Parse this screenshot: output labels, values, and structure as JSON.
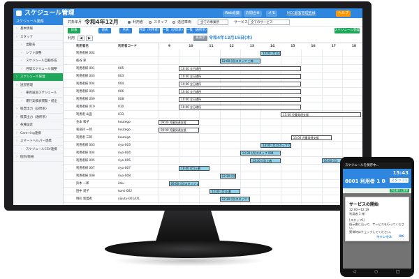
{
  "app": {
    "title": "スケジュール管理",
    "header_buttons": [
      "Web会議",
      "お問合せ",
      "メモ"
    ],
    "user_link": "HCC顧客管理者様",
    "help": "ヘルプ"
  },
  "sidebar": {
    "heading": "スケジュール業務",
    "items": [
      {
        "label": "基本情報",
        "sub": false,
        "active": false
      },
      {
        "label": "スタッフ",
        "sub": false,
        "active": false
      },
      {
        "label": "出勤表",
        "sub": true,
        "active": false
      },
      {
        "label": "シフト調整",
        "sub": true,
        "active": false
      },
      {
        "label": "スケジュール自動作成",
        "sub": true,
        "active": false
      },
      {
        "label": "月間スケジュール調整",
        "sub": true,
        "active": false
      },
      {
        "label": "スケジュール管理",
        "sub": false,
        "active": true
      },
      {
        "label": "送迎管理",
        "sub": false,
        "active": false
      },
      {
        "label": "車両送迎スケジュール",
        "sub": true,
        "active": false
      },
      {
        "label": "運行実績表閲覧・提出",
        "sub": true,
        "active": false
      },
      {
        "label": "帳票出力（訪問系）",
        "sub": false,
        "active": false
      },
      {
        "label": "帳票出力（通所系）",
        "sub": false,
        "active": false
      },
      {
        "label": "各種設定",
        "sub": false,
        "active": false
      },
      {
        "label": "Care-ring連携",
        "sub": false,
        "active": false
      },
      {
        "label": "スマートヘルパー連携",
        "sub": false,
        "active": false
      },
      {
        "label": "スケジュールCSV連携",
        "sub": true,
        "active": false
      },
      {
        "label": "個別/帳紙",
        "sub": false,
        "active": false
      }
    ]
  },
  "header": {
    "target_label": "対象年月",
    "year_month": "令和4年12月",
    "radio_user": "利用者",
    "radio_staff": "スタッフ",
    "radio_send": "送迎車両",
    "office_select": "全ての事業所",
    "service_label": "サービス",
    "service_select": "全てのサービス"
  },
  "toolbar": {
    "buttons": [
      {
        "label": "日表",
        "style": "green"
      },
      {
        "label": "週表",
        "style": "blue"
      },
      {
        "label": "月表",
        "style": "blue"
      },
      {
        "label": "月間（利用者）",
        "style": "blue"
      },
      {
        "label": "一覧（訪問系）",
        "style": "blue"
      },
      {
        "label": "一覧（通所系）",
        "style": "blue"
      }
    ],
    "right_button": "スケジュール登録",
    "refresh_button": "再表示"
  },
  "navigation": {
    "label": "利用",
    "prev": "◀",
    "next": "▶",
    "current_date": "令和4年12月15日(木)"
  },
  "grid": {
    "col_headers": [
      "利用者名",
      "利用者コード"
    ],
    "hours": [
      "9",
      "10",
      "11",
      "12",
      "13",
      "14",
      "15",
      "16",
      "17",
      "18"
    ],
    "rows": [
      {
        "name": "利用者様 002",
        "code": ""
      },
      {
        "name": "栃谷 翠",
        "code": ""
      },
      {
        "name": "利用者様 001",
        "code": "005"
      },
      {
        "name": "利用者様 003",
        "code": "003"
      },
      {
        "name": "利用者様 004",
        "code": "004"
      },
      {
        "name": "利用者様 005",
        "code": "006"
      },
      {
        "name": "利用者様 009",
        "code": "008"
      },
      {
        "name": "利用者様 010",
        "code": "010"
      },
      {
        "name": "利用者 山田",
        "code": "033"
      },
      {
        "name": "金本 和子",
        "code": "houtego"
      },
      {
        "name": "和泉持 一郎",
        "code": "houtego"
      },
      {
        "name": "利用者 三郎",
        "code": "houtego"
      },
      {
        "name": "利用者様 003",
        "code": "riyo-003"
      },
      {
        "name": "利用者様 004",
        "code": "riyo-004"
      },
      {
        "name": "利用者様 005",
        "code": "riyo-005"
      },
      {
        "name": "利用者様 007",
        "code": "riyo-007"
      },
      {
        "name": "利用者様 008",
        "code": "riyo-008"
      },
      {
        "name": "鈴木 一郎",
        "code": "ilalu"
      },
      {
        "name": "田中 道子",
        "code": "komi-002"
      },
      {
        "name": "明彩 新着者",
        "code": "oiyutu-001/LYL"
      }
    ],
    "bars": [
      {
        "row": 0,
        "start": 14.0,
        "end": 15.0,
        "label": "14:00 (月)上着",
        "style": "blue"
      },
      {
        "row": 1,
        "start": 12.0,
        "end": 14.0,
        "label": "12:00 (月)スタッフ 三郎",
        "style": "blue"
      },
      {
        "row": 2,
        "start": 10.0,
        "end": 16.0,
        "label": "10:00 全日通所",
        "style": "white"
      },
      {
        "row": 3,
        "start": 10.0,
        "end": 16.0,
        "label": "10:00 全日通所",
        "style": "white"
      },
      {
        "row": 4,
        "start": 10.0,
        "end": 16.0,
        "label": "10:00 全日通所",
        "style": "white"
      },
      {
        "row": 5,
        "start": 10.0,
        "end": 16.0,
        "label": "10:00 全日通所",
        "style": "white"
      },
      {
        "row": 6,
        "start": 10.0,
        "end": 16.0,
        "label": "10:00 全日通所",
        "style": "white"
      },
      {
        "row": 7,
        "start": 10.0,
        "end": 16.0,
        "label": "10:00 全日通所",
        "style": "white"
      },
      {
        "row": 8,
        "start": 15.0,
        "end": 19.0,
        "label": "15:00 児童発達支援",
        "style": "white"
      },
      {
        "row": 9,
        "start": 9.0,
        "end": 11.0,
        "label": "09:00 児童発達支援",
        "style": "white"
      },
      {
        "row": 10,
        "start": 9.0,
        "end": 11.0,
        "label": "09:00 児童発達支援",
        "style": "white"
      },
      {
        "row": 11,
        "start": 15.5,
        "end": 17.5,
        "label": "15:00 児童発達支援",
        "style": "white"
      },
      {
        "row": 12,
        "start": 14.0,
        "end": 15.5,
        "label": "14:00 (月)スタッフ 003",
        "style": "blue"
      },
      {
        "row": 13,
        "start": 13.0,
        "end": 15.0,
        "label": "13:30 (月)スタッフ 004",
        "style": "blue"
      },
      {
        "row": 14,
        "start": 13.5,
        "end": 15.0,
        "label": "13:30 (月)上着",
        "style": "blue"
      },
      {
        "row": 14,
        "start": 17.0,
        "end": 18.0,
        "label": "16:00 (月)",
        "style": "blue"
      },
      {
        "row": 15,
        "start": 10.0,
        "end": 11.5,
        "label": "10:00 (月)上着",
        "style": "blue"
      },
      {
        "row": 16,
        "start": 12.0,
        "end": 12.8,
        "label": "12:30 (月)上着",
        "style": "blue"
      },
      {
        "row": 17,
        "start": 9.5,
        "end": 11.0,
        "label": "09:00 (月)スタッフ 二子",
        "style": "blue"
      },
      {
        "row": 18,
        "start": 11.5,
        "end": 13.0,
        "label": "12:00 (月)上着",
        "style": "blue"
      },
      {
        "row": 19,
        "start": 12.0,
        "end": 13.5,
        "label": "12:30 (月)スタッフ 二子",
        "style": "blue"
      }
    ]
  },
  "phone": {
    "status": "スケジュールを保存中…",
    "time": "15:43",
    "unit": "8001 利用者 1 B",
    "staff": "スタッフ1",
    "green_button": "予定通りに登録",
    "dialog": {
      "title": "サービスの開始",
      "lines": [
        "12:00〜12:19",
        "利用者 1 様",
        "",
        "[スタッフ1]",
        "指示書に沿って、サービスを行ってください。",
        "異常時はチェックしてください。"
      ],
      "cancel": "キャンセル",
      "ok": "OK"
    }
  },
  "colors": {
    "accent": "#2e86de",
    "active": "#1ea65a",
    "bar_fill": "#8fd4ef",
    "bezel": "#1c1c1e"
  }
}
